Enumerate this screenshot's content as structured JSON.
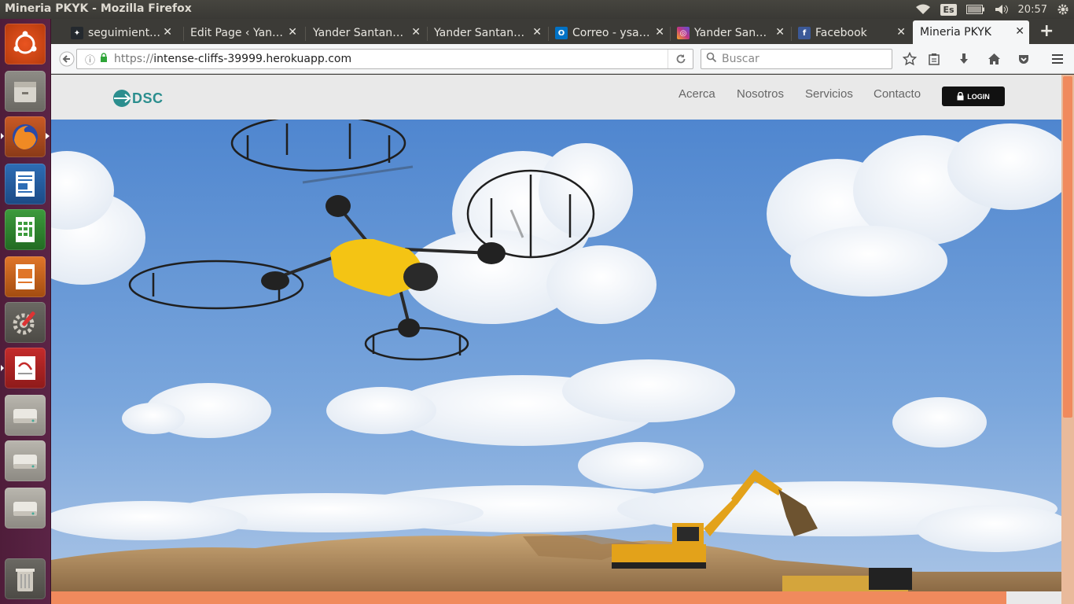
{
  "window": {
    "title": "Mineria PKYK - Mozilla Firefox",
    "keyboard_layout": "Es",
    "clock": "20:57"
  },
  "tabs": [
    {
      "label": "seguimient…",
      "icon": "github-icon",
      "color": "#24292e"
    },
    {
      "label": "Edit Page ‹ Yan…",
      "icon": "wordpress-icon",
      "color": "#3c3b37"
    },
    {
      "label": "Yander Santan…",
      "icon": "",
      "color": "#3c3b37"
    },
    {
      "label": "Yander Santan…",
      "icon": "",
      "color": "#3c3b37"
    },
    {
      "label": "Correo - ysa…",
      "icon": "outlook-icon",
      "color": "#0072c6"
    },
    {
      "label": "Yander San…",
      "icon": "instagram-icon",
      "color": "#c13584"
    },
    {
      "label": "Facebook",
      "icon": "facebook-icon",
      "color": "#3b5998"
    },
    {
      "label": "Mineria PKYK",
      "icon": "",
      "color": "#f5f6f7"
    }
  ],
  "navbar": {
    "url_scheme": "https://",
    "url_host": "intense-cliffs-39999.herokuapp.com",
    "search_placeholder": "Buscar"
  },
  "site": {
    "logo_text": "DSC",
    "nav": [
      "Acerca",
      "Nosotros",
      "Servicios",
      "Contacto"
    ],
    "login_label": "LOGIN"
  },
  "colors": {
    "accent": "#f08a5d",
    "logo": "#2b8e8e",
    "sky": "#6f9cd6",
    "launcher": "#5b2446"
  }
}
